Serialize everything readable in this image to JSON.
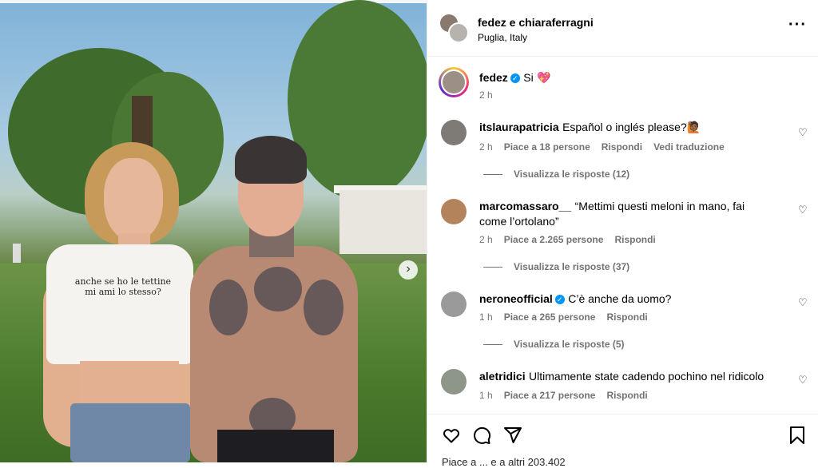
{
  "post": {
    "shirt_text_line1": "anche se ho le tettine",
    "shirt_text_line2": "mi ami lo stesso?"
  },
  "header": {
    "accounts": "fedez e chiaraferragni",
    "location": "Puglia, Italy"
  },
  "caption": {
    "username": "fedez",
    "text": "Si",
    "emoji": "💖",
    "time": "2 h"
  },
  "comments": [
    {
      "username": "itslaurapatricia",
      "verified": false,
      "text": "Español o inglés please?🙋🏾",
      "time": "2 h",
      "likes": "Piace a 18 persone",
      "reply": "Rispondi",
      "translate": "Vedi traduzione",
      "view_replies": "Visualizza le risposte (12)"
    },
    {
      "username": "marcomassaro__",
      "verified": false,
      "text": "“Mettimi questi meloni in mano, fai come l’ortolano”",
      "time": "2 h",
      "likes": "Piace a 2.265 persone",
      "reply": "Rispondi",
      "view_replies": "Visualizza le risposte (37)"
    },
    {
      "username": "neroneofficial",
      "verified": true,
      "text": "C’è anche da uomo?",
      "time": "1 h",
      "likes": "Piace a 265 persone",
      "reply": "Rispondi",
      "view_replies": "Visualizza le risposte (5)"
    },
    {
      "username": "aletridici",
      "verified": false,
      "text": "Ultimamente state cadendo pochino nel ridicolo",
      "time": "1 h",
      "likes": "Piace a 217 persone",
      "reply": "Rispondi"
    }
  ],
  "likes_summary": "Piace a ... e a altri 203.402",
  "icons": {
    "like": "heart-outline-icon",
    "comment": "speech-bubble-icon",
    "share": "paper-plane-icon",
    "save": "bookmark-icon",
    "next": "chevron-right-icon",
    "more": "more-options-icon"
  },
  "colors": {
    "verified": "#0095f6",
    "secondary_text": "#737373",
    "divider": "#efefef"
  }
}
